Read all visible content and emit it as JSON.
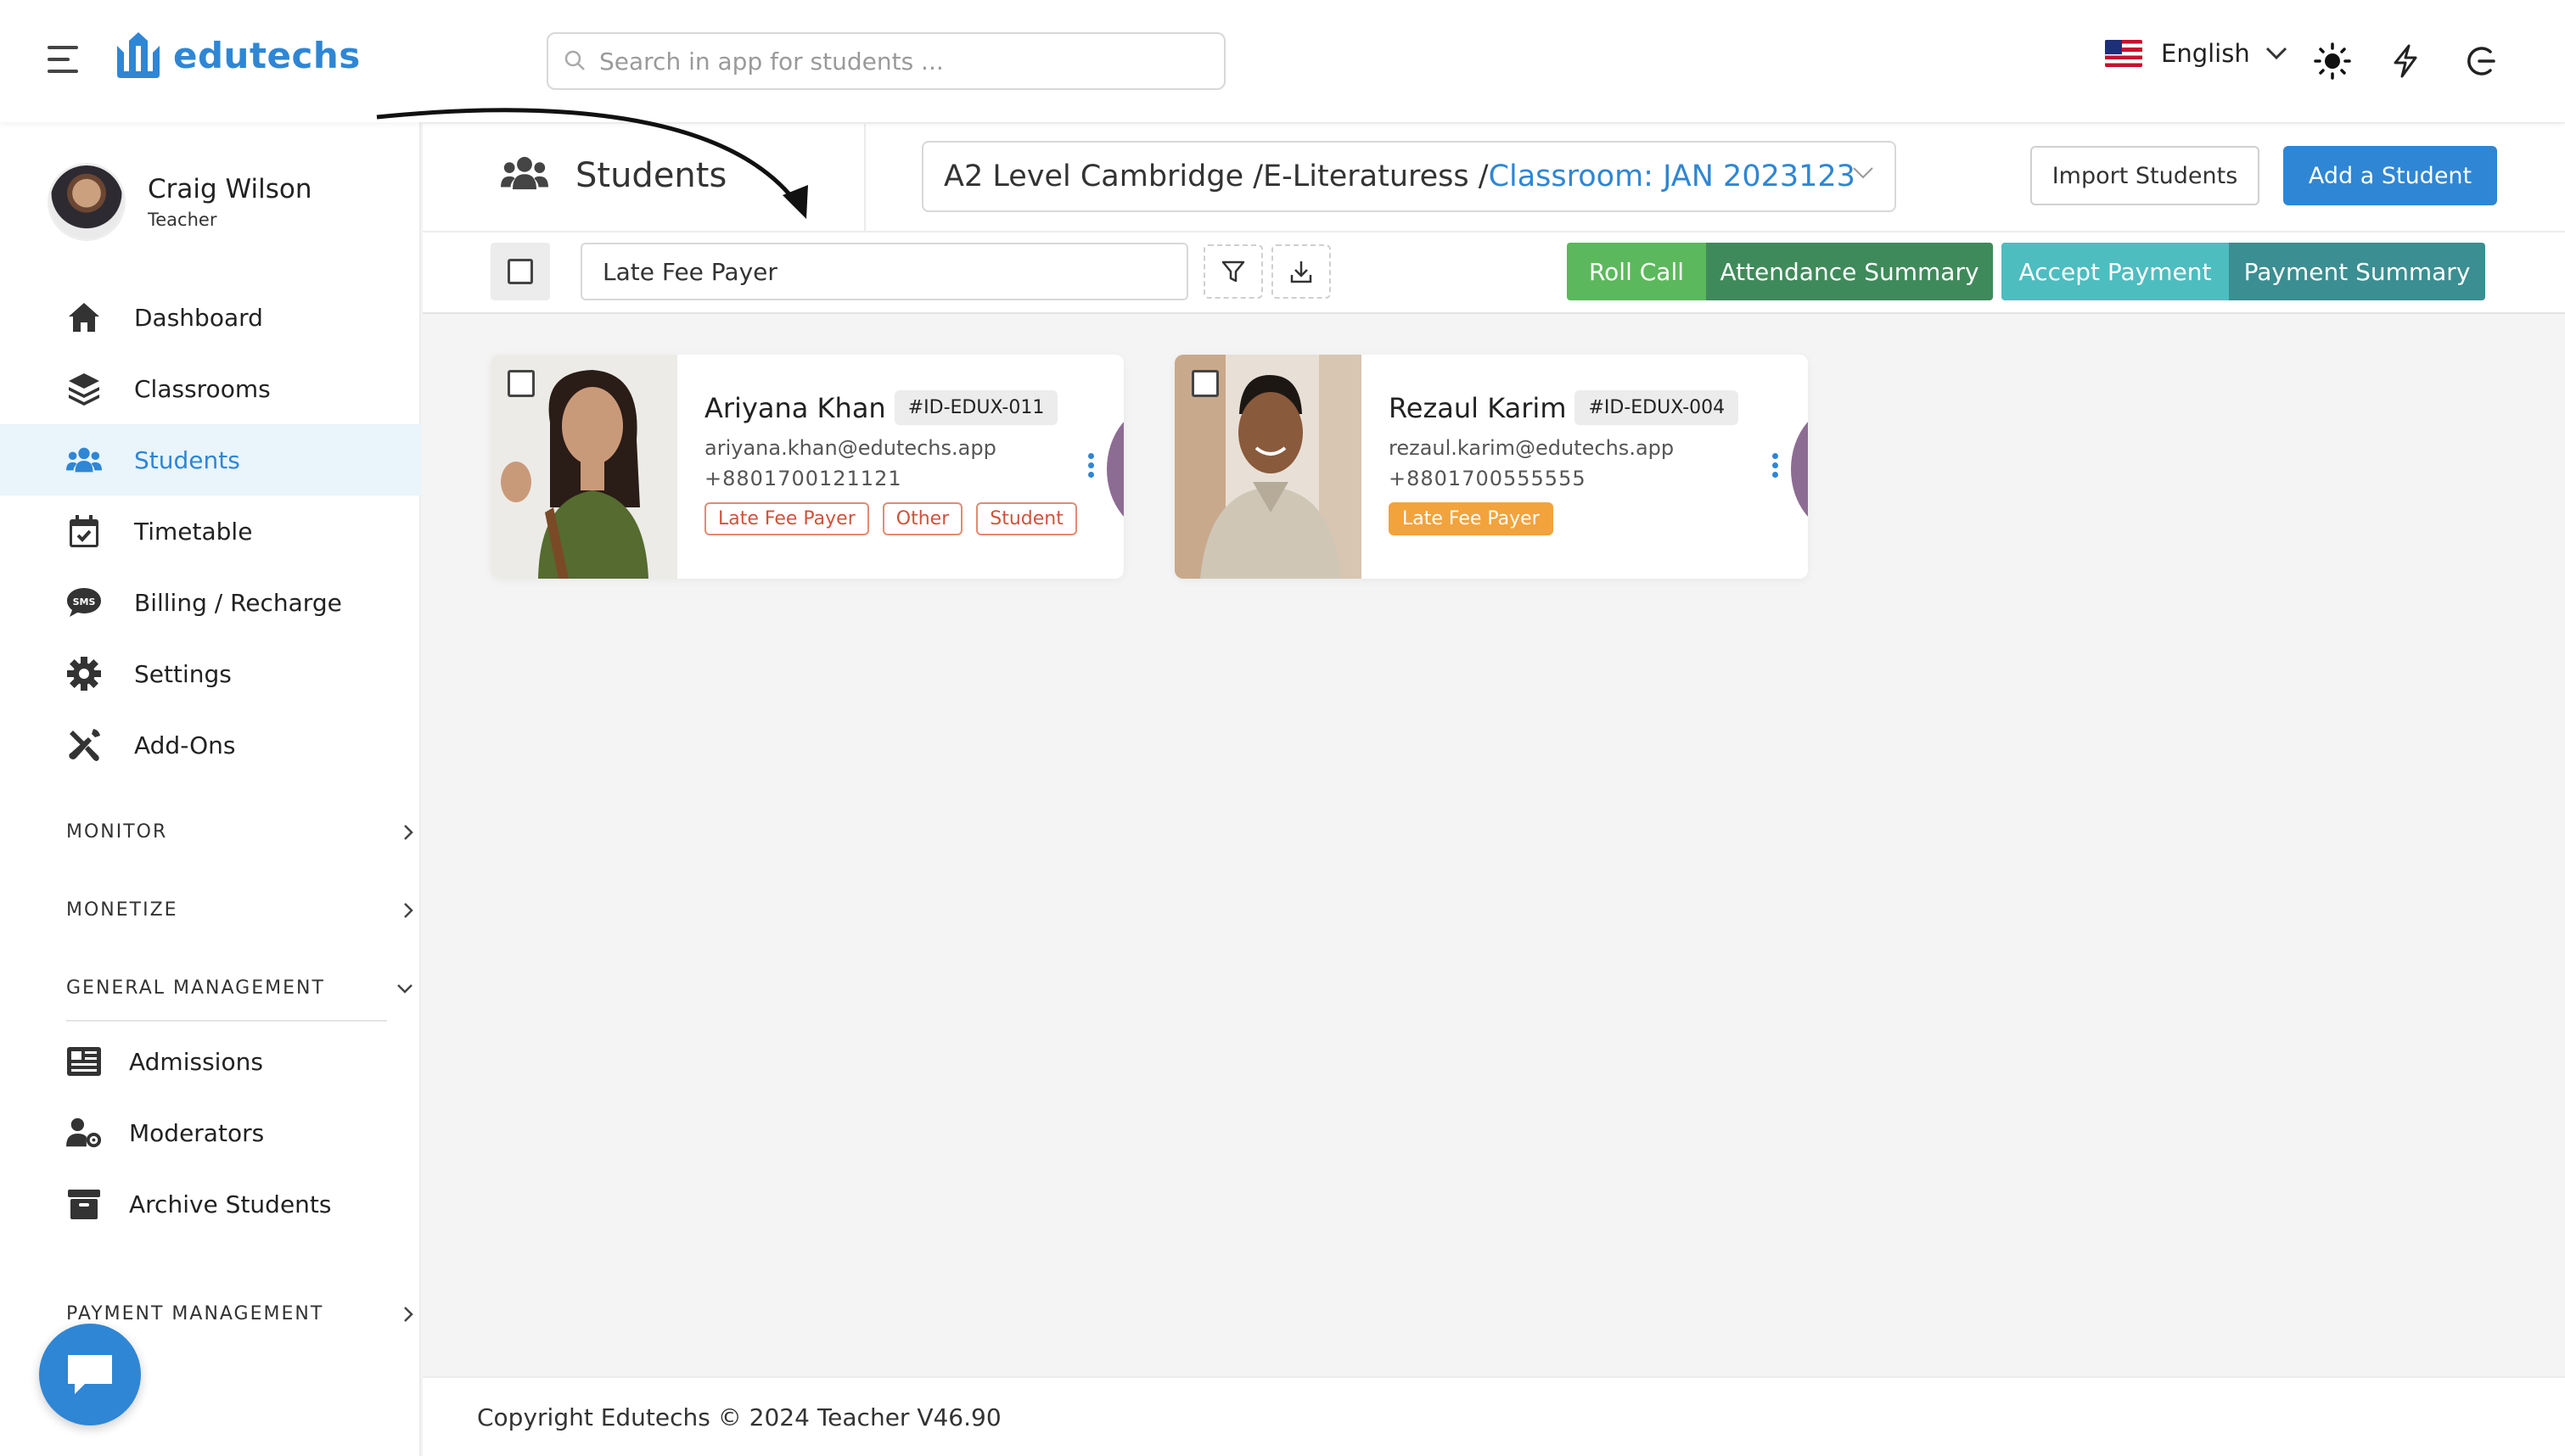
{
  "header": {
    "app_name": "edutechs",
    "search_placeholder": "Search in app for students ...",
    "language": "English",
    "icons": [
      "menu-icon",
      "sun-icon",
      "bolt-icon",
      "logout-icon"
    ]
  },
  "profile": {
    "name": "Craig Wilson",
    "role": "Teacher"
  },
  "sidebar": {
    "items": [
      {
        "label": "Dashboard",
        "icon": "home-icon"
      },
      {
        "label": "Classrooms",
        "icon": "layers-icon"
      },
      {
        "label": "Students",
        "icon": "users-icon",
        "active": true
      },
      {
        "label": "Timetable",
        "icon": "calendar-icon"
      },
      {
        "label": "Billing / Recharge",
        "icon": "sms-icon"
      },
      {
        "label": "Settings",
        "icon": "gear-icon"
      },
      {
        "label": "Add-Ons",
        "icon": "tools-icon"
      }
    ],
    "sections": {
      "monitor": "MONITOR",
      "monetize": "MONETIZE",
      "general": "GENERAL MANAGEMENT",
      "payment": "PAYMENT MANAGEMENT"
    },
    "general_items": [
      {
        "label": "Admissions",
        "icon": "newspaper-icon"
      },
      {
        "label": "Moderators",
        "icon": "user-gear-icon"
      },
      {
        "label": "Archive Students",
        "icon": "archive-icon"
      }
    ]
  },
  "page": {
    "title": "Students",
    "class_path": "A2 Level Cambridge /E-Literaturess /",
    "classroom": "Classroom: JAN 2023123",
    "import_label": "Import Students",
    "add_label": "Add a Student"
  },
  "filter": {
    "value": "Late Fee Payer",
    "buttons": {
      "roll_call": "Roll Call",
      "attendance_summary": "Attendance Summary",
      "accept_payment": "Accept Payment",
      "payment_summary": "Payment Summary"
    }
  },
  "students": [
    {
      "name": "Ariyana Khan",
      "id": "#ID-EDUX-011",
      "email": "ariyana.khan@edutechs.app",
      "phone": "+8801700121121",
      "tags": [
        "Late Fee Payer",
        "Other",
        "Student"
      ]
    },
    {
      "name": "Rezaul Karim",
      "id": "#ID-EDUX-004",
      "email": "rezaul.karim@edutechs.app",
      "phone": "+8801700555555",
      "tags": [
        "Late Fee Payer"
      ]
    }
  ],
  "footer": "Copyright Edutechs © 2024 Teacher V46.90",
  "colors": {
    "primary": "#2f86d4",
    "roll_call": "#5cb85c",
    "attendance": "#3f8a5a",
    "accept_payment": "#4dbdc0",
    "payment_summary": "#3b8e91",
    "late_fee_tag": "#f2a33c"
  }
}
